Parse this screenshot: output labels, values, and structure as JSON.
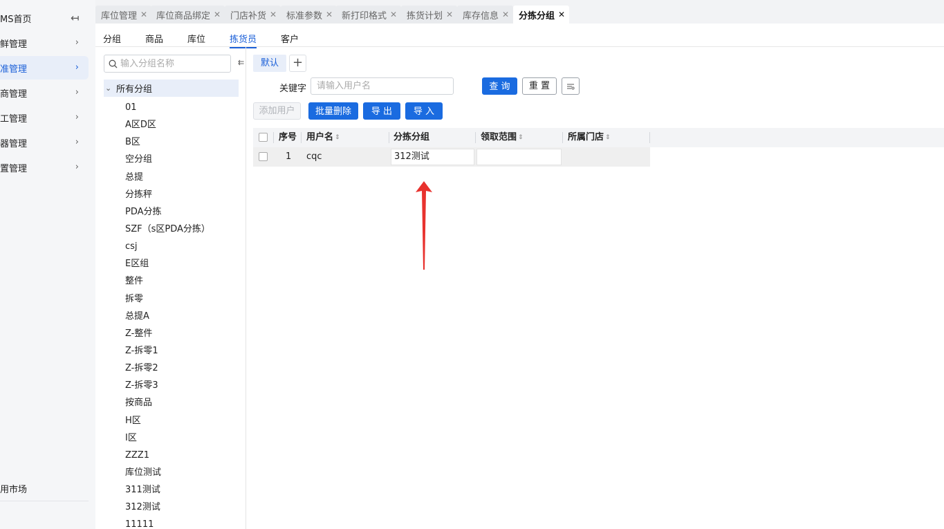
{
  "sidebar": {
    "items": [
      {
        "label": "MS首页"
      },
      {
        "label": "鲜管理"
      },
      {
        "label": "准管理"
      },
      {
        "label": "商管理"
      },
      {
        "label": "工管理"
      },
      {
        "label": "器管理"
      },
      {
        "label": "置管理"
      }
    ],
    "bottom_item": "用市场"
  },
  "tabs": [
    {
      "label": "库位管理"
    },
    {
      "label": "库位商品绑定"
    },
    {
      "label": "门店补货"
    },
    {
      "label": "标准参数"
    },
    {
      "label": "新打印格式"
    },
    {
      "label": "拣货计划"
    },
    {
      "label": "库存信息"
    },
    {
      "label": "分拣分组"
    }
  ],
  "subtabs": [
    {
      "label": "分组"
    },
    {
      "label": "商品"
    },
    {
      "label": "库位"
    },
    {
      "label": "拣货员"
    },
    {
      "label": "客户"
    }
  ],
  "tree": {
    "search_placeholder": "输入分组名称",
    "root": "所有分组",
    "children": [
      "01",
      "A区D区",
      "B区",
      "空分组",
      "总提",
      "分拣秤",
      "PDA分拣",
      "SZF（s区PDA分拣）",
      "csj",
      "E区组",
      "整件",
      "拆零",
      "总提A",
      "Z-整件",
      "Z-拆零1",
      "Z-拆零2",
      "Z-拆零3",
      "按商品",
      "H区",
      "I区",
      "ZZZ1",
      "库位测试",
      "311测试",
      "312测试",
      "11111"
    ]
  },
  "main": {
    "scheme_tab": "默认",
    "keyword_label": "关键字",
    "keyword_placeholder": "请输入用户名",
    "query_button": "查 询",
    "reset_button": "重 置",
    "add_user_button": "添加用户",
    "batch_delete_button": "批量删除",
    "export_button": "导 出",
    "import_button": "导 入"
  },
  "table": {
    "columns": [
      "序号",
      "用户名",
      "分拣分组",
      "领取范围",
      "所属门店"
    ],
    "rows": [
      {
        "index": "1",
        "username": "cqc",
        "group": "312测试",
        "range": "",
        "store": ""
      }
    ]
  },
  "colors": {
    "accent": "#1a6be0",
    "annotation_arrow": "#e8322e"
  }
}
